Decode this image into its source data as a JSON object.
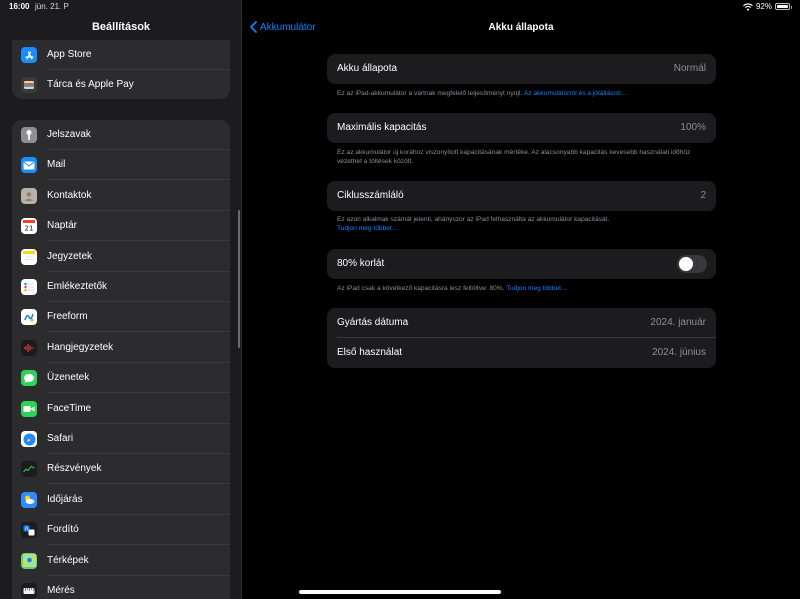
{
  "status_bar": {
    "time": "16:00",
    "date": "jún. 21. P",
    "battery": "92%"
  },
  "sidebar": {
    "title": "Beállítások",
    "group1": [
      {
        "label": "App Store",
        "icon": "app-store-icon",
        "color": "#1a8cff"
      },
      {
        "label": "Tárca és Apple Pay",
        "icon": "wallet-icon",
        "color": "#3a3a3c"
      }
    ],
    "group2": [
      {
        "label": "Jelszavak",
        "icon": "key-icon",
        "color": "#8e8e93"
      },
      {
        "label": "Mail",
        "icon": "mail-icon",
        "color": "#1a8cff"
      },
      {
        "label": "Kontaktok",
        "icon": "contacts-icon",
        "color": "#b9b2a6"
      },
      {
        "label": "Naptár",
        "icon": "calendar-icon",
        "color": "#ffffff"
      },
      {
        "label": "Jegyzetek",
        "icon": "notes-icon",
        "color": "#ffffff"
      },
      {
        "label": "Emlékeztetők",
        "icon": "reminders-icon",
        "color": "#ffffff"
      },
      {
        "label": "Freeform",
        "icon": "freeform-icon",
        "color": "#ffffff"
      },
      {
        "label": "Hangjegyzetek",
        "icon": "voice-memos-icon",
        "color": "#1c1c1e"
      },
      {
        "label": "Üzenetek",
        "icon": "messages-icon",
        "color": "#30d158"
      },
      {
        "label": "FaceTime",
        "icon": "facetime-icon",
        "color": "#30d158"
      },
      {
        "label": "Safari",
        "icon": "safari-icon",
        "color": "#ffffff"
      },
      {
        "label": "Részvények",
        "icon": "stocks-icon",
        "color": "#1c1c1e"
      },
      {
        "label": "Időjárás",
        "icon": "weather-icon",
        "color": "#2f8cff"
      },
      {
        "label": "Fordító",
        "icon": "translate-icon",
        "color": "#1c1c1e"
      },
      {
        "label": "Térképek",
        "icon": "maps-icon",
        "color": "#6fcf6f"
      },
      {
        "label": "Mérés",
        "icon": "measure-icon",
        "color": "#1c1c1e"
      }
    ]
  },
  "main": {
    "back_label": "Akkumulátor",
    "title": "Akku állapota",
    "health": {
      "label": "Akku állapota",
      "value": "Normál"
    },
    "health_note": "Ez az iPad-akkumulátor a vártnak megfelelő teljesítményt nyújt.",
    "health_link": "Az akkumulátorról és a jótállásról…",
    "capacity": {
      "label": "Maximális kapacitás",
      "value": "100%"
    },
    "capacity_note": "Ez az akkumulátor új korához viszonyított kapacitásának mértéke. Az alacsonyabb kapacitás kevesebb használati időhöz vezethet a töltések között.",
    "cycle": {
      "label": "Ciklusszámláló",
      "value": "2"
    },
    "cycle_note": "Ez azon alkalmak számát jelenti, ahányszor az iPad felhasználta az akkumulátor kapacitását.",
    "cycle_link": "Tudjon meg többet…",
    "limit": {
      "label": "80% korlát",
      "on": false
    },
    "limit_note": "Az iPad csak a következő kapacitásra lesz feltöltve: 80%.",
    "limit_link": "Tudjon meg többet…",
    "manufacture": {
      "label": "Gyártás dátuma",
      "value": "2024. január"
    },
    "first_use": {
      "label": "Első használat",
      "value": "2024. június"
    }
  },
  "colors": {
    "accent": "#0a84ff",
    "card_bg": "#1c1c1e",
    "secondary_text": "#8e8e93"
  }
}
